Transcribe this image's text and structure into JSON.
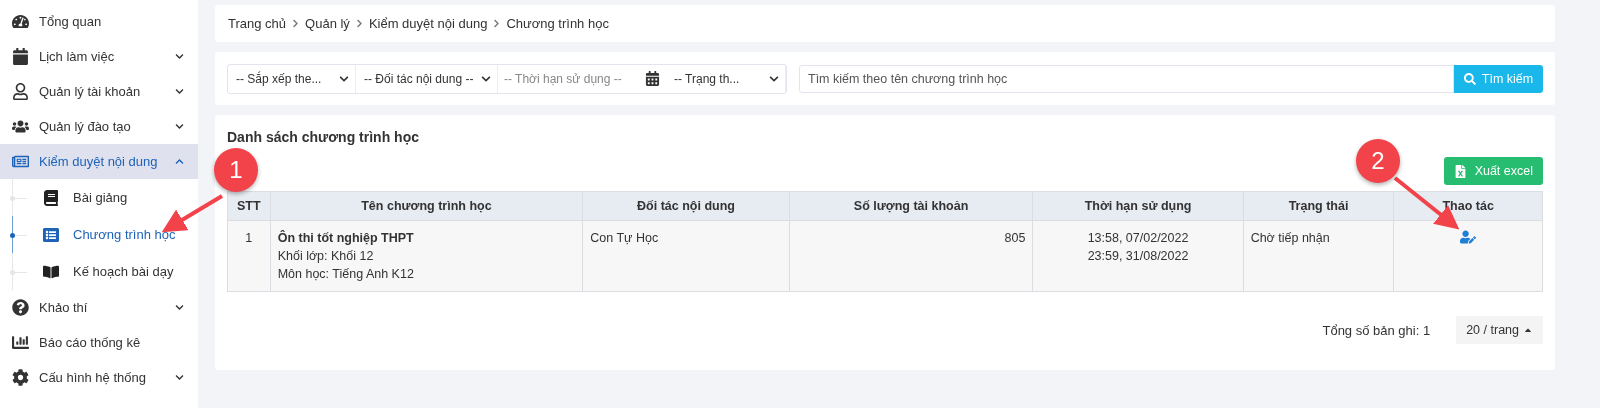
{
  "sidebar": {
    "items": [
      {
        "label": "Tổng quan",
        "kind": "link",
        "selected": false
      },
      {
        "label": "Lịch làm việc",
        "kind": "group",
        "selected": false,
        "expanded": false
      },
      {
        "label": "Quản lý tài khoản",
        "kind": "group",
        "selected": false,
        "expanded": false
      },
      {
        "label": "Quản lý đào tạo",
        "kind": "group",
        "selected": false,
        "expanded": false
      },
      {
        "label": "Kiểm duyệt nội dung",
        "kind": "group",
        "selected": true,
        "expanded": true,
        "children": [
          {
            "label": "Bài giảng",
            "selected": false
          },
          {
            "label": "Chương trình học",
            "selected": true
          },
          {
            "label": "Kế hoạch bài dạy",
            "selected": false
          }
        ]
      },
      {
        "label": "Khảo thí",
        "kind": "group",
        "selected": false,
        "expanded": false
      },
      {
        "label": "Báo cáo thống kê",
        "kind": "link",
        "selected": false
      },
      {
        "label": "Cấu hình hệ thống",
        "kind": "group",
        "selected": false,
        "expanded": false
      }
    ]
  },
  "breadcrumb": [
    "Trang chủ",
    "Quản lý",
    "Kiểm duyệt nội dung",
    "Chương trình học"
  ],
  "filters": [
    {
      "kind": "select",
      "value": "-- Sắp xếp the..."
    },
    {
      "kind": "select",
      "value": "-- Đối tác nội dung --"
    },
    {
      "kind": "date",
      "placeholder": "-- Thời hạn sử dụng --"
    },
    {
      "kind": "select",
      "value": "-- Trạng th..."
    }
  ],
  "search": {
    "placeholder": "Tìm kiếm theo tên chương trình học",
    "button": "Tìm kiếm"
  },
  "list": {
    "title": "Danh sách chương trình học",
    "export_button": "Xuất excel",
    "table": {
      "columns": [
        "STT",
        "Tên chương trình học",
        "Đối tác nội dung",
        "Số lượng tài khoản",
        "Thời hạn sử dụng",
        "Trạng thái",
        "Thao tác"
      ],
      "rows": [
        {
          "stt": "1",
          "name": "Ôn thi tốt nghiệp THPT",
          "grade": "Khối lớp: Khối 12",
          "subject": "Môn học: Tiếng Anh K12",
          "partner": "Con Tự Học",
          "accounts": "805",
          "start": "13:58, 07/02/2022",
          "end": "23:59, 31/08/2022",
          "status": "Chờ tiếp nhận"
        }
      ]
    },
    "total": "Tổng số bản ghi: 1",
    "page_size": "20 / trang"
  },
  "callouts": [
    "1",
    "2"
  ]
}
